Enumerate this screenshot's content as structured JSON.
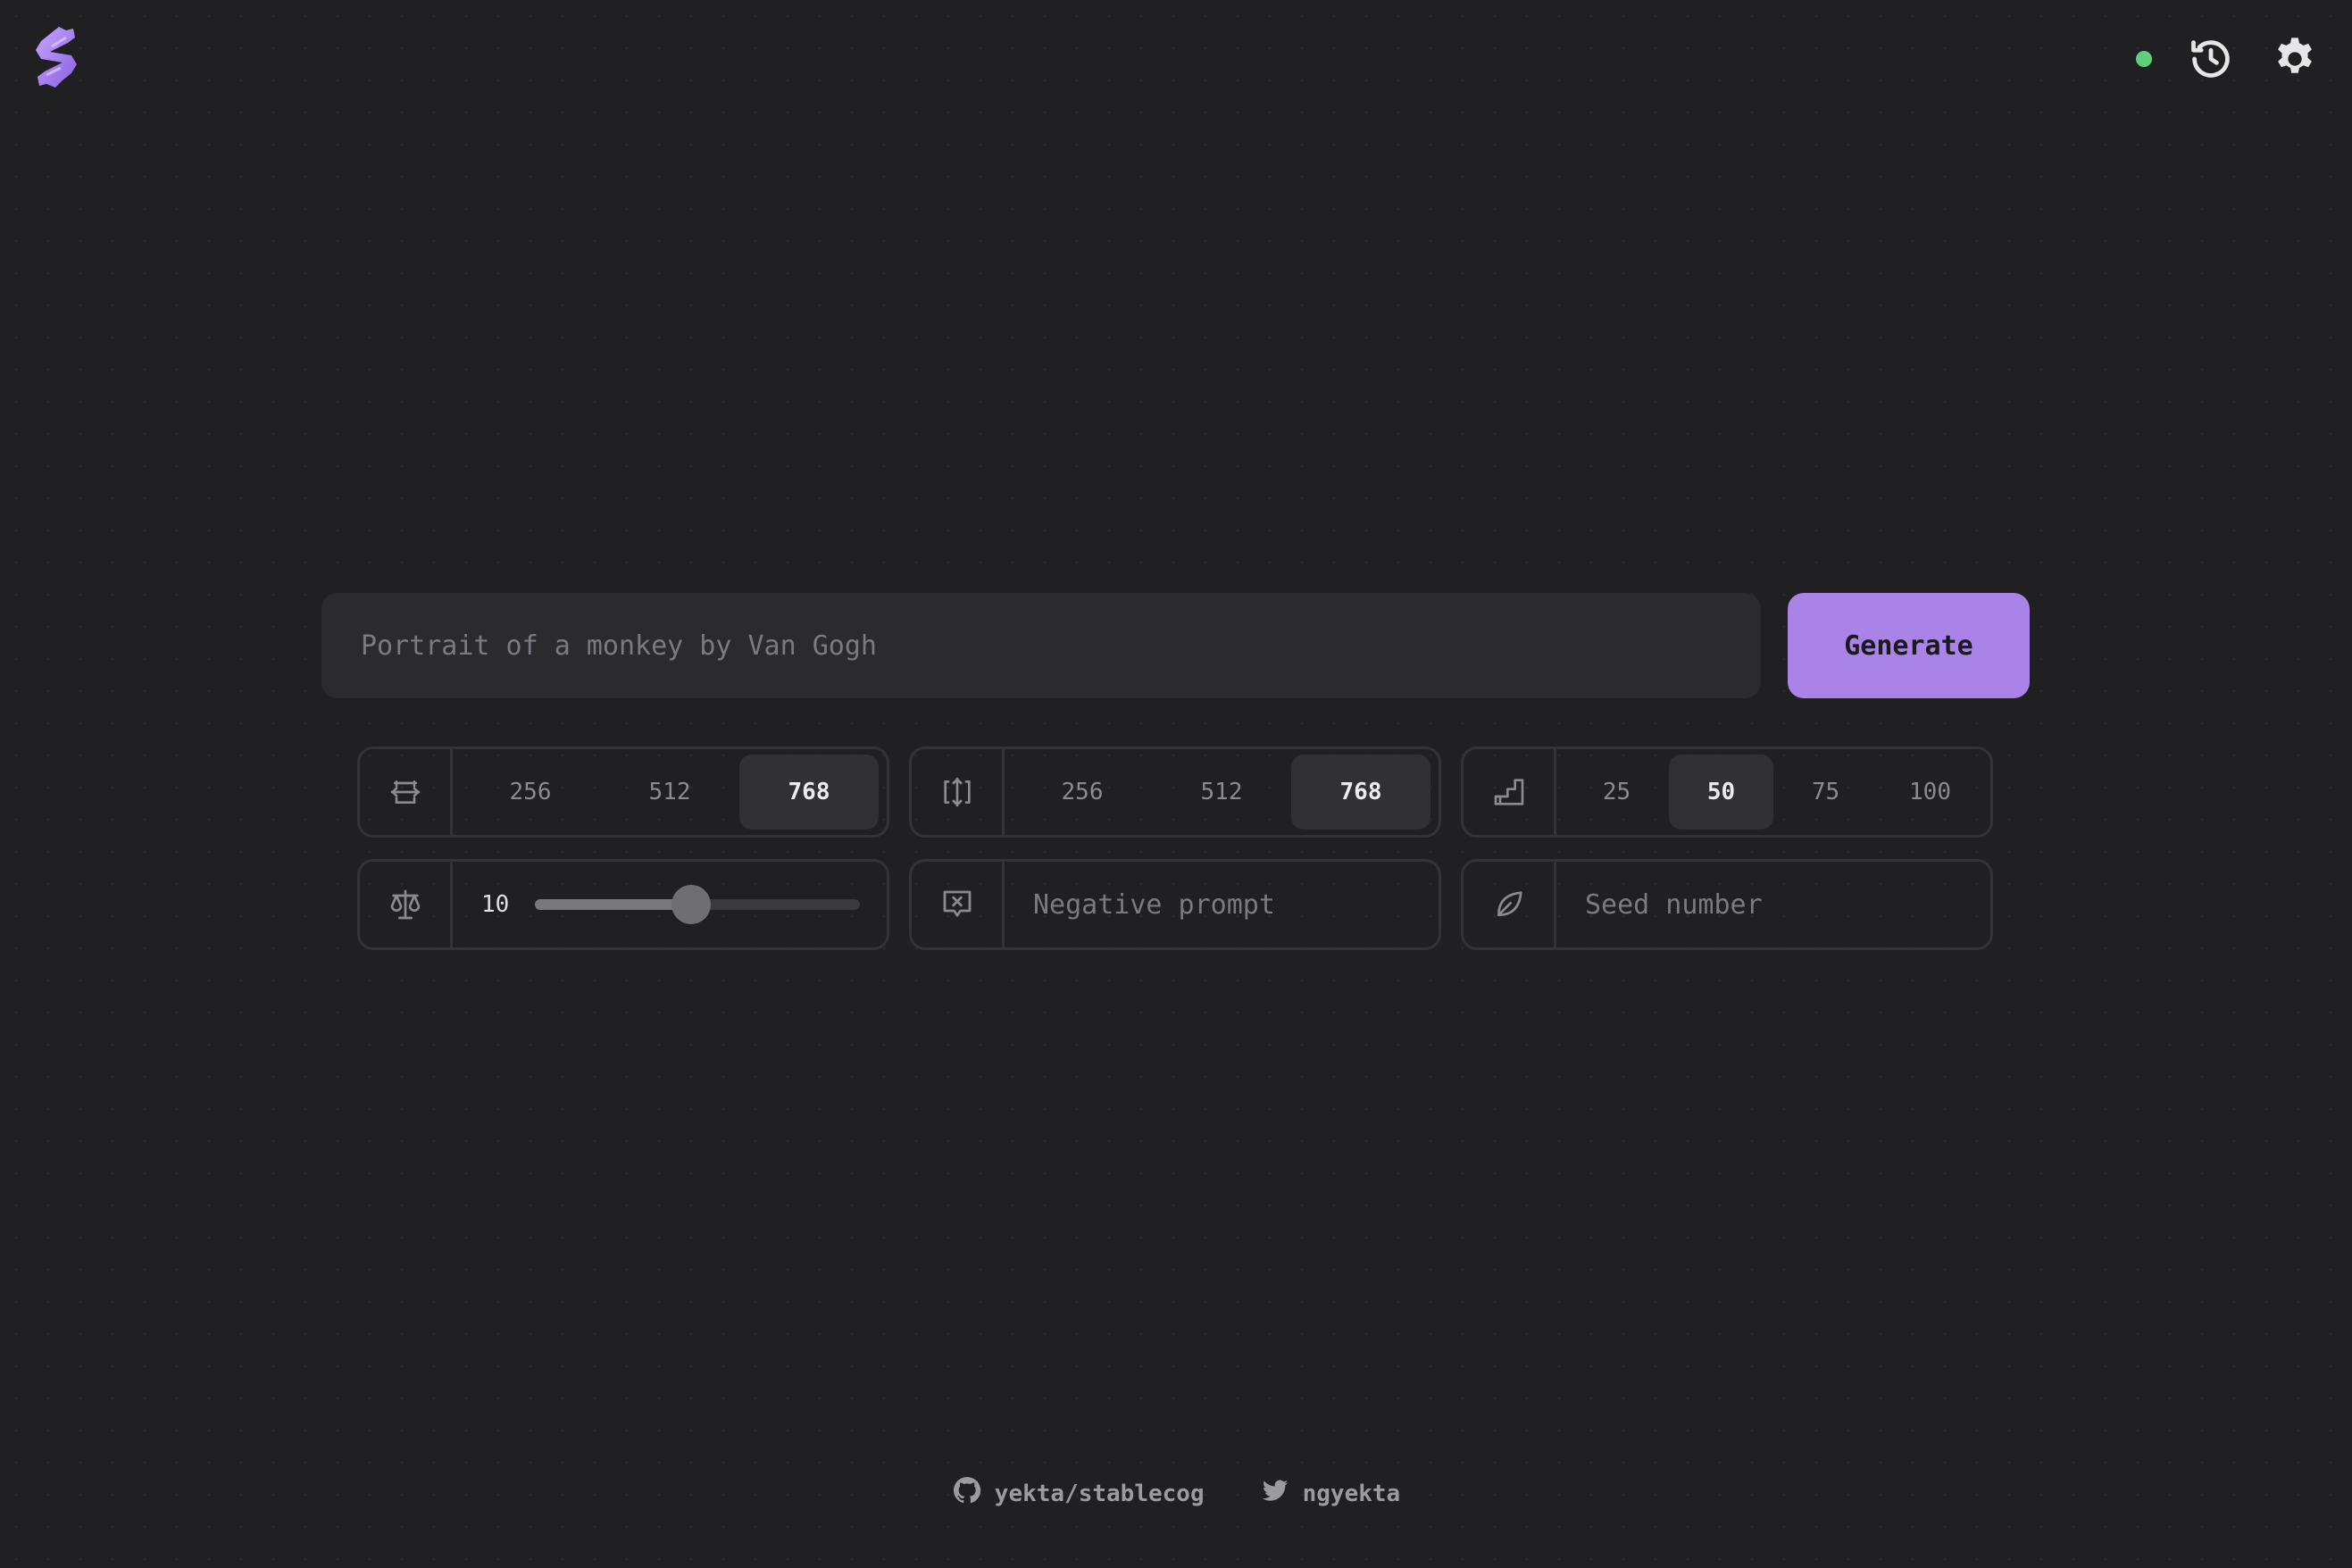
{
  "header": {
    "logo_icon": "stablecog-logo-icon",
    "status_color": "#5fd07a",
    "history_icon": "history-icon",
    "settings_icon": "gear-icon"
  },
  "prompt": {
    "placeholder": "Portrait of a monkey by Van Gogh",
    "value": "",
    "generate_label": "Generate",
    "accent_color": "#a983e8"
  },
  "width": {
    "icon": "width-arrows-icon",
    "options": [
      "256",
      "512",
      "768"
    ],
    "selected": "768"
  },
  "height": {
    "icon": "height-arrows-icon",
    "options": [
      "256",
      "512",
      "768"
    ],
    "selected": "768"
  },
  "steps": {
    "icon": "steps-icon",
    "options": [
      "25",
      "50",
      "75",
      "100"
    ],
    "selected": "50"
  },
  "guidance": {
    "icon": "scale-icon",
    "value": "10",
    "fraction": 0.48
  },
  "negative_prompt": {
    "icon": "negative-prompt-icon",
    "placeholder": "Negative prompt",
    "value": ""
  },
  "seed": {
    "icon": "seed-leaf-icon",
    "placeholder": "Seed number",
    "value": ""
  },
  "footer": {
    "github_icon": "github-icon",
    "github_label": "yekta/stablecog",
    "twitter_icon": "twitter-icon",
    "twitter_label": "ngyekta"
  }
}
